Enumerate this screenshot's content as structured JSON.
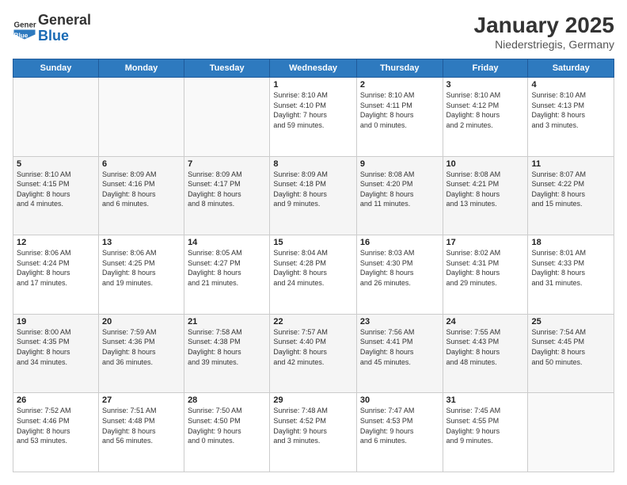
{
  "header": {
    "logo_general": "General",
    "logo_blue": "Blue",
    "month_title": "January 2025",
    "location": "Niederstriegis, Germany"
  },
  "weekdays": [
    "Sunday",
    "Monday",
    "Tuesday",
    "Wednesday",
    "Thursday",
    "Friday",
    "Saturday"
  ],
  "weeks": [
    [
      {
        "day": "",
        "info": ""
      },
      {
        "day": "",
        "info": ""
      },
      {
        "day": "",
        "info": ""
      },
      {
        "day": "1",
        "info": "Sunrise: 8:10 AM\nSunset: 4:10 PM\nDaylight: 7 hours\nand 59 minutes."
      },
      {
        "day": "2",
        "info": "Sunrise: 8:10 AM\nSunset: 4:11 PM\nDaylight: 8 hours\nand 0 minutes."
      },
      {
        "day": "3",
        "info": "Sunrise: 8:10 AM\nSunset: 4:12 PM\nDaylight: 8 hours\nand 2 minutes."
      },
      {
        "day": "4",
        "info": "Sunrise: 8:10 AM\nSunset: 4:13 PM\nDaylight: 8 hours\nand 3 minutes."
      }
    ],
    [
      {
        "day": "5",
        "info": "Sunrise: 8:10 AM\nSunset: 4:15 PM\nDaylight: 8 hours\nand 4 minutes."
      },
      {
        "day": "6",
        "info": "Sunrise: 8:09 AM\nSunset: 4:16 PM\nDaylight: 8 hours\nand 6 minutes."
      },
      {
        "day": "7",
        "info": "Sunrise: 8:09 AM\nSunset: 4:17 PM\nDaylight: 8 hours\nand 8 minutes."
      },
      {
        "day": "8",
        "info": "Sunrise: 8:09 AM\nSunset: 4:18 PM\nDaylight: 8 hours\nand 9 minutes."
      },
      {
        "day": "9",
        "info": "Sunrise: 8:08 AM\nSunset: 4:20 PM\nDaylight: 8 hours\nand 11 minutes."
      },
      {
        "day": "10",
        "info": "Sunrise: 8:08 AM\nSunset: 4:21 PM\nDaylight: 8 hours\nand 13 minutes."
      },
      {
        "day": "11",
        "info": "Sunrise: 8:07 AM\nSunset: 4:22 PM\nDaylight: 8 hours\nand 15 minutes."
      }
    ],
    [
      {
        "day": "12",
        "info": "Sunrise: 8:06 AM\nSunset: 4:24 PM\nDaylight: 8 hours\nand 17 minutes."
      },
      {
        "day": "13",
        "info": "Sunrise: 8:06 AM\nSunset: 4:25 PM\nDaylight: 8 hours\nand 19 minutes."
      },
      {
        "day": "14",
        "info": "Sunrise: 8:05 AM\nSunset: 4:27 PM\nDaylight: 8 hours\nand 21 minutes."
      },
      {
        "day": "15",
        "info": "Sunrise: 8:04 AM\nSunset: 4:28 PM\nDaylight: 8 hours\nand 24 minutes."
      },
      {
        "day": "16",
        "info": "Sunrise: 8:03 AM\nSunset: 4:30 PM\nDaylight: 8 hours\nand 26 minutes."
      },
      {
        "day": "17",
        "info": "Sunrise: 8:02 AM\nSunset: 4:31 PM\nDaylight: 8 hours\nand 29 minutes."
      },
      {
        "day": "18",
        "info": "Sunrise: 8:01 AM\nSunset: 4:33 PM\nDaylight: 8 hours\nand 31 minutes."
      }
    ],
    [
      {
        "day": "19",
        "info": "Sunrise: 8:00 AM\nSunset: 4:35 PM\nDaylight: 8 hours\nand 34 minutes."
      },
      {
        "day": "20",
        "info": "Sunrise: 7:59 AM\nSunset: 4:36 PM\nDaylight: 8 hours\nand 36 minutes."
      },
      {
        "day": "21",
        "info": "Sunrise: 7:58 AM\nSunset: 4:38 PM\nDaylight: 8 hours\nand 39 minutes."
      },
      {
        "day": "22",
        "info": "Sunrise: 7:57 AM\nSunset: 4:40 PM\nDaylight: 8 hours\nand 42 minutes."
      },
      {
        "day": "23",
        "info": "Sunrise: 7:56 AM\nSunset: 4:41 PM\nDaylight: 8 hours\nand 45 minutes."
      },
      {
        "day": "24",
        "info": "Sunrise: 7:55 AM\nSunset: 4:43 PM\nDaylight: 8 hours\nand 48 minutes."
      },
      {
        "day": "25",
        "info": "Sunrise: 7:54 AM\nSunset: 4:45 PM\nDaylight: 8 hours\nand 50 minutes."
      }
    ],
    [
      {
        "day": "26",
        "info": "Sunrise: 7:52 AM\nSunset: 4:46 PM\nDaylight: 8 hours\nand 53 minutes."
      },
      {
        "day": "27",
        "info": "Sunrise: 7:51 AM\nSunset: 4:48 PM\nDaylight: 8 hours\nand 56 minutes."
      },
      {
        "day": "28",
        "info": "Sunrise: 7:50 AM\nSunset: 4:50 PM\nDaylight: 9 hours\nand 0 minutes."
      },
      {
        "day": "29",
        "info": "Sunrise: 7:48 AM\nSunset: 4:52 PM\nDaylight: 9 hours\nand 3 minutes."
      },
      {
        "day": "30",
        "info": "Sunrise: 7:47 AM\nSunset: 4:53 PM\nDaylight: 9 hours\nand 6 minutes."
      },
      {
        "day": "31",
        "info": "Sunrise: 7:45 AM\nSunset: 4:55 PM\nDaylight: 9 hours\nand 9 minutes."
      },
      {
        "day": "",
        "info": ""
      }
    ]
  ]
}
